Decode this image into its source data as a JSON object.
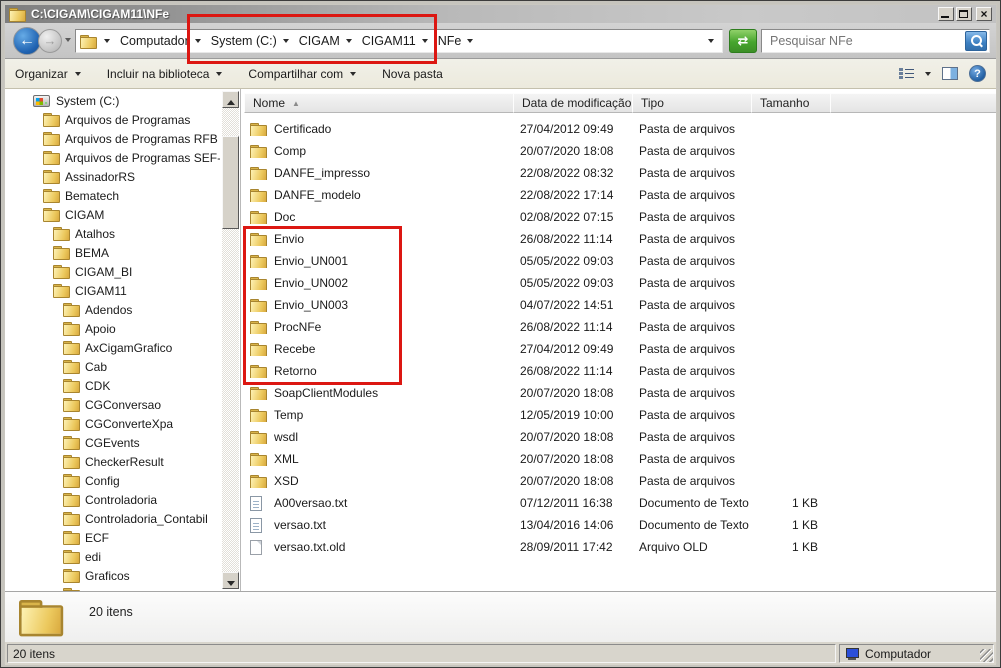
{
  "window": {
    "title": "C:\\CIGAM\\CIGAM11\\NFe"
  },
  "address_bar": {
    "breadcrumb": [
      "Computador",
      "System (C:)",
      "CIGAM",
      "CIGAM11",
      "NFe"
    ],
    "search_placeholder": "Pesquisar NFe"
  },
  "toolbar": {
    "items": [
      {
        "label": "Organizar",
        "dropdown": true
      },
      {
        "label": "Incluir na biblioteca",
        "dropdown": true
      },
      {
        "label": "Compartilhar com",
        "dropdown": true
      },
      {
        "label": "Nova pasta",
        "dropdown": false
      }
    ]
  },
  "tree": {
    "items": [
      {
        "label": "System (C:)",
        "icon": "drive",
        "level": 1
      },
      {
        "label": "Arquivos de Programas",
        "icon": "folder",
        "level": 2
      },
      {
        "label": "Arquivos de Programas RFB",
        "icon": "folder",
        "level": 2
      },
      {
        "label": "Arquivos de Programas SEF-MG",
        "icon": "folder",
        "level": 2
      },
      {
        "label": "AssinadorRS",
        "icon": "folder",
        "level": 2
      },
      {
        "label": "Bematech",
        "icon": "folder",
        "level": 2
      },
      {
        "label": "CIGAM",
        "icon": "folder",
        "level": 2
      },
      {
        "label": "Atalhos",
        "icon": "folder",
        "level": 3
      },
      {
        "label": "BEMA",
        "icon": "folder",
        "level": 3
      },
      {
        "label": "CIGAM_BI",
        "icon": "folder",
        "level": 3
      },
      {
        "label": "CIGAM11",
        "icon": "folder",
        "level": 3
      },
      {
        "label": "Adendos",
        "icon": "folder",
        "level": 4
      },
      {
        "label": "Apoio",
        "icon": "folder",
        "level": 4
      },
      {
        "label": "AxCigamGrafico",
        "icon": "folder",
        "level": 4
      },
      {
        "label": "Cab",
        "icon": "folder",
        "level": 4
      },
      {
        "label": "CDK",
        "icon": "folder",
        "level": 4
      },
      {
        "label": "CGConversao",
        "icon": "folder",
        "level": 4
      },
      {
        "label": "CGConverteXpa",
        "icon": "folder",
        "level": 4
      },
      {
        "label": "CGEvents",
        "icon": "folder",
        "level": 4
      },
      {
        "label": "CheckerResult",
        "icon": "folder",
        "level": 4
      },
      {
        "label": "Config",
        "icon": "folder",
        "level": 4
      },
      {
        "label": "Controladoria",
        "icon": "folder",
        "level": 4
      },
      {
        "label": "Controladoria_Contabil",
        "icon": "folder",
        "level": 4
      },
      {
        "label": "ECF",
        "icon": "folder",
        "level": 4
      },
      {
        "label": "edi",
        "icon": "folder",
        "level": 4
      },
      {
        "label": "Graficos",
        "icon": "folder",
        "level": 4
      },
      {
        "label": "",
        "icon": "folder",
        "level": 4
      }
    ]
  },
  "filelist": {
    "columns": [
      "Nome",
      "Data de modificação",
      "Tipo",
      "Tamanho"
    ],
    "sort": {
      "column": "Nome",
      "direction": "asc"
    },
    "rows": [
      {
        "name": "Certificado",
        "date": "27/04/2012 09:49",
        "type": "Pasta de arquivos",
        "size": "",
        "icon": "folder"
      },
      {
        "name": "Comp",
        "date": "20/07/2020 18:08",
        "type": "Pasta de arquivos",
        "size": "",
        "icon": "folder"
      },
      {
        "name": "DANFE_impresso",
        "date": "22/08/2022 08:32",
        "type": "Pasta de arquivos",
        "size": "",
        "icon": "folder"
      },
      {
        "name": "DANFE_modelo",
        "date": "22/08/2022 17:14",
        "type": "Pasta de arquivos",
        "size": "",
        "icon": "folder"
      },
      {
        "name": "Doc",
        "date": "02/08/2022 07:15",
        "type": "Pasta de arquivos",
        "size": "",
        "icon": "folder"
      },
      {
        "name": "Envio",
        "date": "26/08/2022 11:14",
        "type": "Pasta de arquivos",
        "size": "",
        "icon": "folder"
      },
      {
        "name": "Envio_UN001",
        "date": "05/05/2022 09:03",
        "type": "Pasta de arquivos",
        "size": "",
        "icon": "folder"
      },
      {
        "name": "Envio_UN002",
        "date": "05/05/2022 09:03",
        "type": "Pasta de arquivos",
        "size": "",
        "icon": "folder"
      },
      {
        "name": "Envio_UN003",
        "date": "04/07/2022 14:51",
        "type": "Pasta de arquivos",
        "size": "",
        "icon": "folder"
      },
      {
        "name": "ProcNFe",
        "date": "26/08/2022 11:14",
        "type": "Pasta de arquivos",
        "size": "",
        "icon": "folder"
      },
      {
        "name": "Recebe",
        "date": "27/04/2012 09:49",
        "type": "Pasta de arquivos",
        "size": "",
        "icon": "folder"
      },
      {
        "name": "Retorno",
        "date": "26/08/2022 11:14",
        "type": "Pasta de arquivos",
        "size": "",
        "icon": "folder"
      },
      {
        "name": "SoapClientModules",
        "date": "20/07/2020 18:08",
        "type": "Pasta de arquivos",
        "size": "",
        "icon": "folder"
      },
      {
        "name": "Temp",
        "date": "12/05/2019 10:00",
        "type": "Pasta de arquivos",
        "size": "",
        "icon": "folder"
      },
      {
        "name": "wsdl",
        "date": "20/07/2020 18:08",
        "type": "Pasta de arquivos",
        "size": "",
        "icon": "folder"
      },
      {
        "name": "XML",
        "date": "20/07/2020 18:08",
        "type": "Pasta de arquivos",
        "size": "",
        "icon": "folder"
      },
      {
        "name": "XSD",
        "date": "20/07/2020 18:08",
        "type": "Pasta de arquivos",
        "size": "",
        "icon": "folder"
      },
      {
        "name": "A00versao.txt",
        "date": "07/12/2011 16:38",
        "type": "Documento de Texto",
        "size": "1 KB",
        "icon": "text"
      },
      {
        "name": "versao.txt",
        "date": "13/04/2016 14:06",
        "type": "Documento de Texto",
        "size": "1 KB",
        "icon": "text"
      },
      {
        "name": "versao.txt.old",
        "date": "28/09/2011 17:42",
        "type": "Arquivo OLD",
        "size": "1 KB",
        "icon": "file"
      }
    ]
  },
  "details_pane": {
    "text": "20 itens"
  },
  "status_bar": {
    "left": "20 itens",
    "right": "Computador"
  },
  "annotations": {
    "highlight_color": "#dc1712"
  }
}
